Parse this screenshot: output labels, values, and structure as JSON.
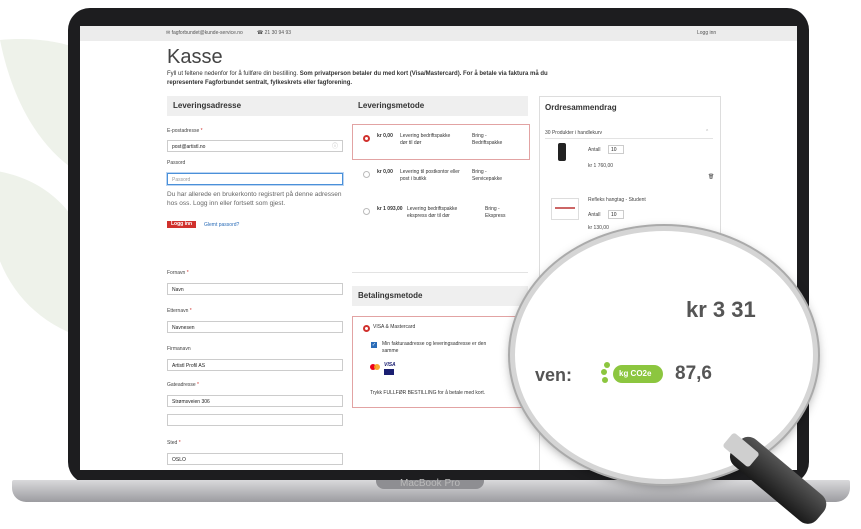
{
  "topbar": {
    "email": "fagforbundet@kunde-service.no",
    "phone": "21 30 94 93",
    "login": "Logg inn"
  },
  "page": {
    "title": "Kasse",
    "intro_plain": "Fyll ut feltene nedenfor for å fullføre din bestilling.",
    "intro_bold": "Som privatperson betaler du med kort (Visa/Mastercard). For å betale via faktura må du representere Fagforbundet sentralt, fylkeskrets eller fagforening."
  },
  "delivery_address": {
    "heading": "Leveringsadresse",
    "email_label": "E-postadresse",
    "email_value": "post@artistl.no",
    "password_label": "Passord",
    "password_placeholder": "Passord",
    "account_hint": "Du har allerede en brukerkonto registrert på denne adressen hos oss. Logg inn eller fortsett som gjest.",
    "login_button": "Logg inn",
    "forgot_link": "Glemt passord?",
    "firstname_label": "Fornavn",
    "firstname_value": "Navn",
    "lastname_label": "Etternavn",
    "lastname_value": "Navnesen",
    "company_label": "Firmanavn",
    "company_value": "Artistl Profil AS",
    "street_label": "Gateadresse",
    "street_value": "Strømsveien 306",
    "city_label": "Sted",
    "city_value": "OSLO"
  },
  "delivery_method": {
    "heading": "Leveringsmetode",
    "options": [
      {
        "price": "kr 0,00",
        "desc": "Levering bedriftspakke dør til dør",
        "carrier": "Bring - Bedriftspakke",
        "selected": true
      },
      {
        "price": "kr 0,00",
        "desc": "Levering til postkontor eller post i butikk",
        "carrier": "Bring - Servicepakke",
        "selected": false
      },
      {
        "price": "kr 1 093,00",
        "desc": "Levering bedriftspakke ekspress dør til dør",
        "carrier": "Bring - Ekspress",
        "selected": false
      }
    ]
  },
  "payment": {
    "heading": "Betalingsmetode",
    "method": "VISA & Mastercard",
    "same_address": "Min fakturaadresse og leveringsadresse er den samme",
    "note": "Trykk FULLFØR BESTILLING for å betale med kort.",
    "card_logo": "VISA"
  },
  "order_summary": {
    "heading": "Ordresammendrag",
    "cart_count": "30 Produkter i handlekurv",
    "items": [
      {
        "name": "",
        "qty_label": "Antall",
        "qty": "10",
        "price": "kr 1 760,00"
      },
      {
        "name": "Refleks hangtag - Student",
        "qty_label": "Antall",
        "qty": "10",
        "price": "kr 130,00"
      }
    ]
  },
  "magnifier": {
    "total": "kr 3 31",
    "co2_label": "ven:",
    "co2_badge": "kg CO2e",
    "co2_value": "87,6"
  },
  "device": {
    "brand": "MacBook Pro"
  },
  "colors": {
    "accent": "#d0312d",
    "link": "#2a6cb8",
    "leaf_green": "#8cc63f",
    "bg_leaf": "#eef2ea"
  }
}
